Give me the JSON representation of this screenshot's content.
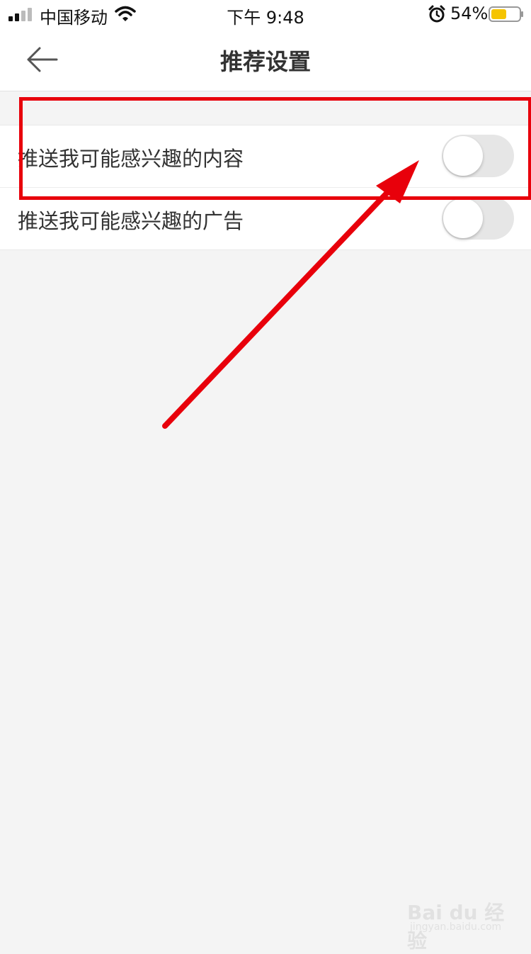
{
  "status_bar": {
    "carrier": "中国移动",
    "time": "下午 9:48",
    "battery_percent": "54%",
    "icons": [
      "signal-icon",
      "wifi-icon",
      "alarm-icon",
      "battery-icon"
    ],
    "battery_level": 0.54,
    "battery_color": "#f5c400"
  },
  "nav": {
    "title": "推荐设置",
    "back_icon": "back-arrow-icon"
  },
  "settings": [
    {
      "label": "推送我可能感兴趣的内容",
      "enabled": false
    },
    {
      "label": "推送我可能感兴趣的广告",
      "enabled": false
    }
  ],
  "annotation": {
    "color": "#e8000b",
    "highlighted_item": "推送我可能感兴趣的内容"
  },
  "watermark": {
    "brand": "Bai du 经验",
    "site": "jingyan.baidu.com"
  },
  "colors": {
    "background": "#f4f4f4",
    "surface": "#ffffff",
    "toggle_off": "#e6e6e6",
    "text": "#333333"
  }
}
